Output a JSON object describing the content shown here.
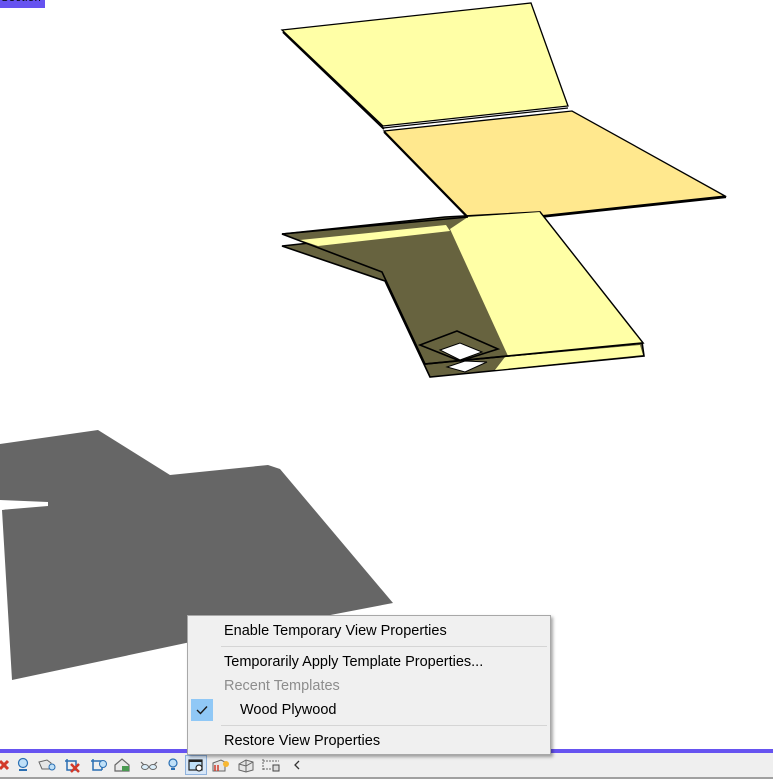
{
  "viewport": {
    "corner_tag": "Section",
    "colors": {
      "view_border": "#6653f0",
      "plate_light": "#ffffa6",
      "plate_top_face": "#ffe88e",
      "plate_shadowed": "#67633f",
      "shadow": "#666666",
      "edge": "#000000",
      "background": "#ffffff"
    }
  },
  "context_menu": {
    "items": [
      {
        "label": "Enable Temporary View Properties",
        "enabled": true,
        "checked": false
      },
      {
        "label": "Temporarily Apply Template Properties...",
        "enabled": true,
        "checked": false
      },
      {
        "label": "Recent Templates",
        "enabled": false,
        "checked": false
      },
      {
        "label": "Wood Plywood",
        "enabled": true,
        "checked": true
      },
      {
        "label": "Restore View Properties",
        "enabled": true,
        "checked": false
      }
    ],
    "check_color": "#90c8f6"
  },
  "status_bar": {
    "icons": [
      {
        "name": "remove-hidden-icon"
      },
      {
        "name": "sun-path-icon"
      },
      {
        "name": "shadows-icon"
      },
      {
        "name": "crop-view-icon"
      },
      {
        "name": "show-crop-region-icon"
      },
      {
        "name": "unlock-3d-view-icon"
      },
      {
        "name": "temporary-hide-isolate-icon"
      },
      {
        "name": "reveal-hidden-elements-icon"
      },
      {
        "name": "temporary-view-properties-icon",
        "active": true
      },
      {
        "name": "show-analytical-model-icon"
      },
      {
        "name": "highlight-displacement-icon"
      },
      {
        "name": "reveal-constraints-icon"
      },
      {
        "name": "collapse-arrow-icon"
      }
    ]
  }
}
